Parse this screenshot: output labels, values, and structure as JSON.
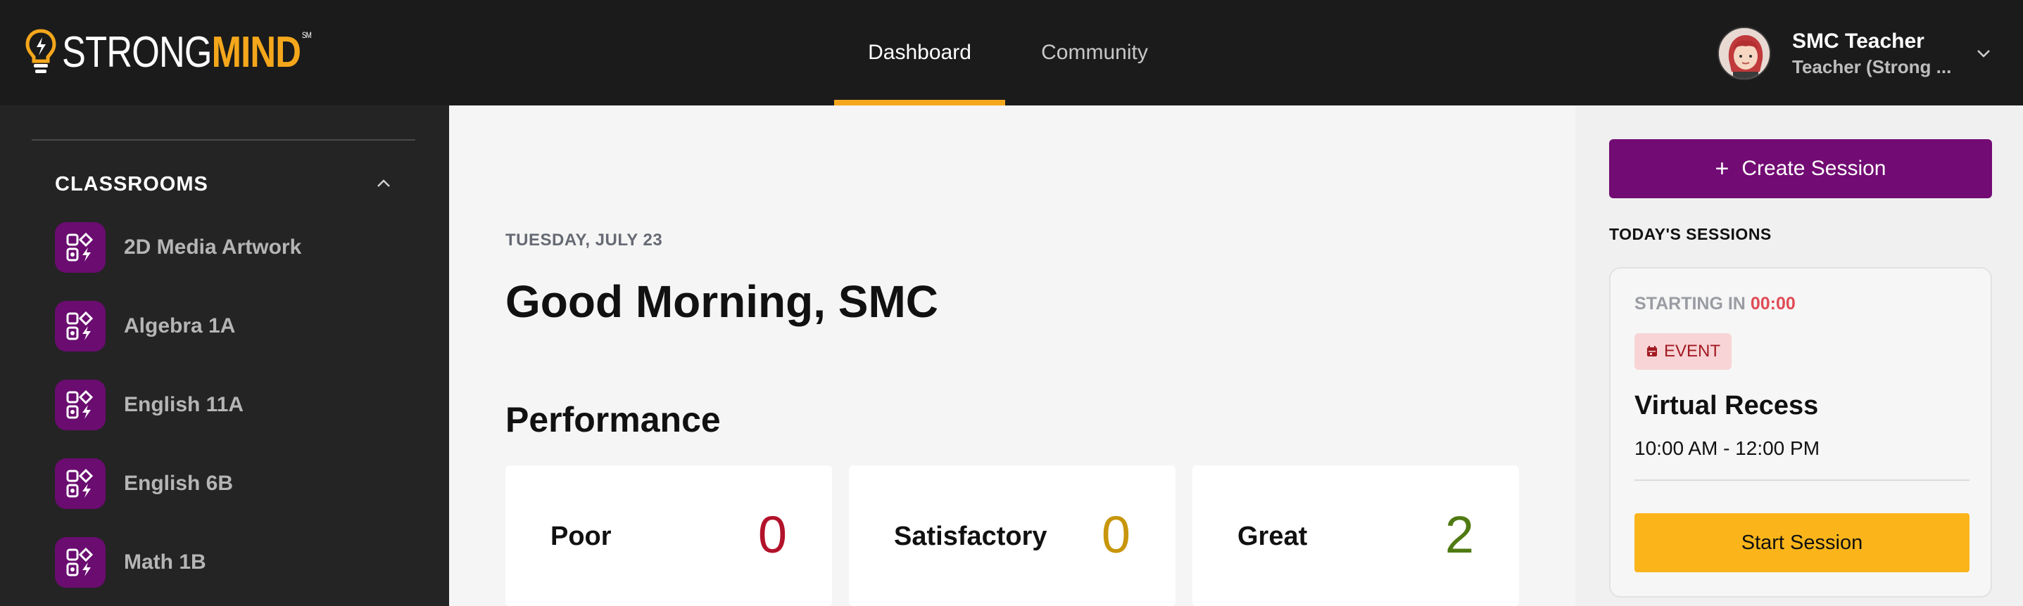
{
  "header": {
    "logo": {
      "part1": "STRONG",
      "part2": "MIND",
      "mark": "SM"
    },
    "nav": [
      {
        "label": "Dashboard",
        "active": true
      },
      {
        "label": "Community",
        "active": false
      }
    ],
    "user": {
      "name": "SMC Teacher",
      "role": "Teacher (Strong ..."
    }
  },
  "sidebar": {
    "section_title": "CLASSROOMS",
    "classrooms": [
      {
        "label": "2D Media Artwork"
      },
      {
        "label": "Algebra 1A"
      },
      {
        "label": "English 11A"
      },
      {
        "label": "English 6B"
      },
      {
        "label": "Math 1B"
      }
    ]
  },
  "main": {
    "date": "TUESDAY, JULY 23",
    "greeting": "Good Morning, SMC",
    "performance_title": "Performance",
    "performance": [
      {
        "label": "Poor",
        "value": "0",
        "color": "#b3122b"
      },
      {
        "label": "Satisfactory",
        "value": "0",
        "color": "#c8960c"
      },
      {
        "label": "Great",
        "value": "2",
        "color": "#4f7a12"
      }
    ]
  },
  "right_panel": {
    "create_button": "Create Session",
    "todays_sessions_title": "TODAY'S SESSIONS",
    "session": {
      "starting_label": "STARTING IN",
      "starting_time": "00:00",
      "badge": "EVENT",
      "title": "Virtual Recess",
      "time": "10:00 AM - 12:00 PM",
      "start_button": "Start Session"
    }
  },
  "colors": {
    "accent": "#f5a71b",
    "brand_purple": "#720b73",
    "start_button": "#fbb51b"
  }
}
